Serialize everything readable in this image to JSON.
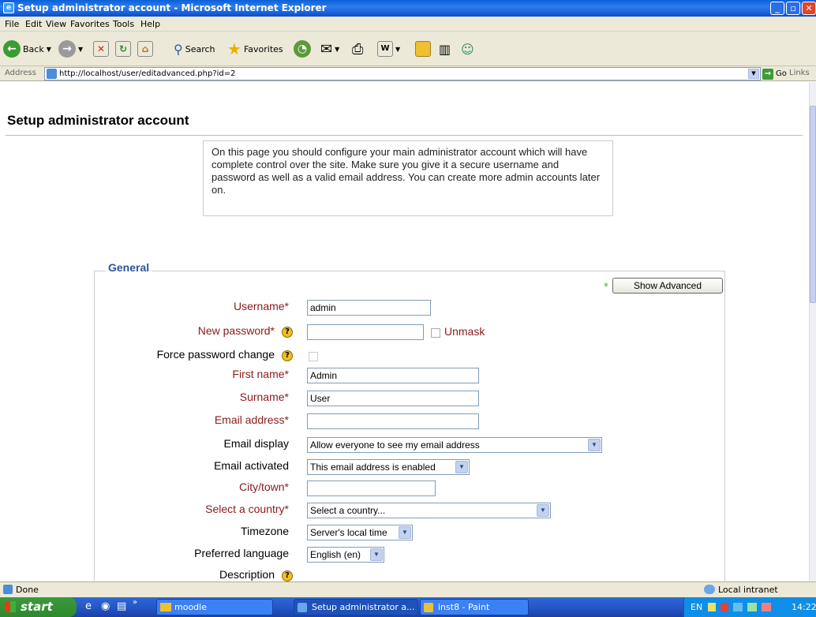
{
  "window": {
    "title": "Setup administrator account - Microsoft Internet Explorer"
  },
  "menu": [
    "File",
    "Edit",
    "View",
    "Favorites",
    "Tools",
    "Help"
  ],
  "toolbar": {
    "back": "Back",
    "search": "Search",
    "favorites": "Favorites"
  },
  "address": {
    "label": "Address",
    "url": "http://localhost/user/editadvanced.php?id=2",
    "go": "Go",
    "links": "Links"
  },
  "page": {
    "title": "Setup administrator account",
    "notice": "On this page you should configure your main administrator account which will have complete control over the site. Make sure you give it a secure username and password as well as a valid email address. You can create more admin accounts later on.",
    "legend": "General",
    "show_advanced": "Show Advanced",
    "form": {
      "username": {
        "label": "Username*",
        "value": "admin"
      },
      "new_password": {
        "label": "New password*",
        "value": "",
        "unmask": "Unmask"
      },
      "force_password_change": {
        "label": "Force password change"
      },
      "first_name": {
        "label": "First name*",
        "value": "Admin"
      },
      "surname": {
        "label": "Surname*",
        "value": "User"
      },
      "email": {
        "label": "Email address*",
        "value": ""
      },
      "email_display": {
        "label": "Email display",
        "value": "Allow everyone to see my email address"
      },
      "email_activated": {
        "label": "Email activated",
        "value": "This email address is enabled"
      },
      "city": {
        "label": "City/town*",
        "value": ""
      },
      "country": {
        "label": "Select a country*",
        "value": "Select a country..."
      },
      "timezone": {
        "label": "Timezone",
        "value": "Server's local time"
      },
      "language": {
        "label": "Preferred language",
        "value": "English (en)"
      },
      "description": {
        "label": "Description"
      }
    }
  },
  "status": {
    "text": "Done",
    "zone": "Local intranet"
  },
  "taskbar": {
    "start": "start",
    "tasks": [
      "moodle",
      "Setup administrator a...",
      "inst8 - Paint"
    ],
    "lang": "EN",
    "time": "14:22"
  }
}
